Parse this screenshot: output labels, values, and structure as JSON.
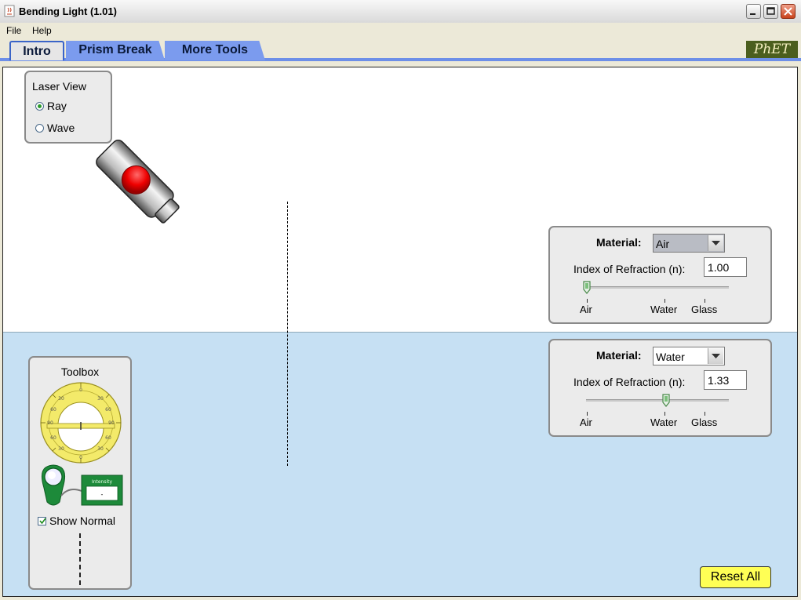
{
  "window": {
    "title": "Bending Light (1.01)",
    "app_icon": "java-cup-icon",
    "controls": [
      "minimize-icon",
      "maximize-icon",
      "close-icon"
    ]
  },
  "menu": {
    "items": [
      "File",
      "Help"
    ]
  },
  "tabs": [
    {
      "label": "Intro",
      "active": true
    },
    {
      "label": "Prism Break",
      "active": false
    },
    {
      "label": "More Tools",
      "active": false
    }
  ],
  "logo": {
    "text": "PhET"
  },
  "laser_view": {
    "heading": "Laser View",
    "options": [
      {
        "label": "Ray",
        "selected": true
      },
      {
        "label": "Wave",
        "selected": false
      }
    ]
  },
  "laser": {
    "icon": "laser-pointer-icon",
    "button_color": "#ee0000"
  },
  "top_medium": {
    "material_label": "Material:",
    "material_value": "Air",
    "ior_label": "Index of Refraction (n):",
    "ior_value": "1.00",
    "slider_value": 1.0,
    "slider_range": [
      1.0,
      1.6
    ],
    "tick_labels": [
      "Air",
      "Water",
      "Glass"
    ],
    "background": "#ffffff"
  },
  "bottom_medium": {
    "material_label": "Material:",
    "material_value": "Water",
    "ior_label": "Index of Refraction (n):",
    "ior_value": "1.33",
    "slider_value": 1.33,
    "slider_range": [
      1.0,
      1.6
    ],
    "tick_labels": [
      "Air",
      "Water",
      "Glass"
    ],
    "background": "#c6e0f3"
  },
  "toolbox": {
    "heading": "Toolbox",
    "protractor_icon": "protractor-icon",
    "intensity_meter": {
      "icon": "intensity-meter-icon",
      "title": "Intensity",
      "reading": "-"
    },
    "show_normal": {
      "label": "Show Normal",
      "checked": true
    }
  },
  "reset_button": {
    "label": "Reset All",
    "color": "#ffff55"
  }
}
